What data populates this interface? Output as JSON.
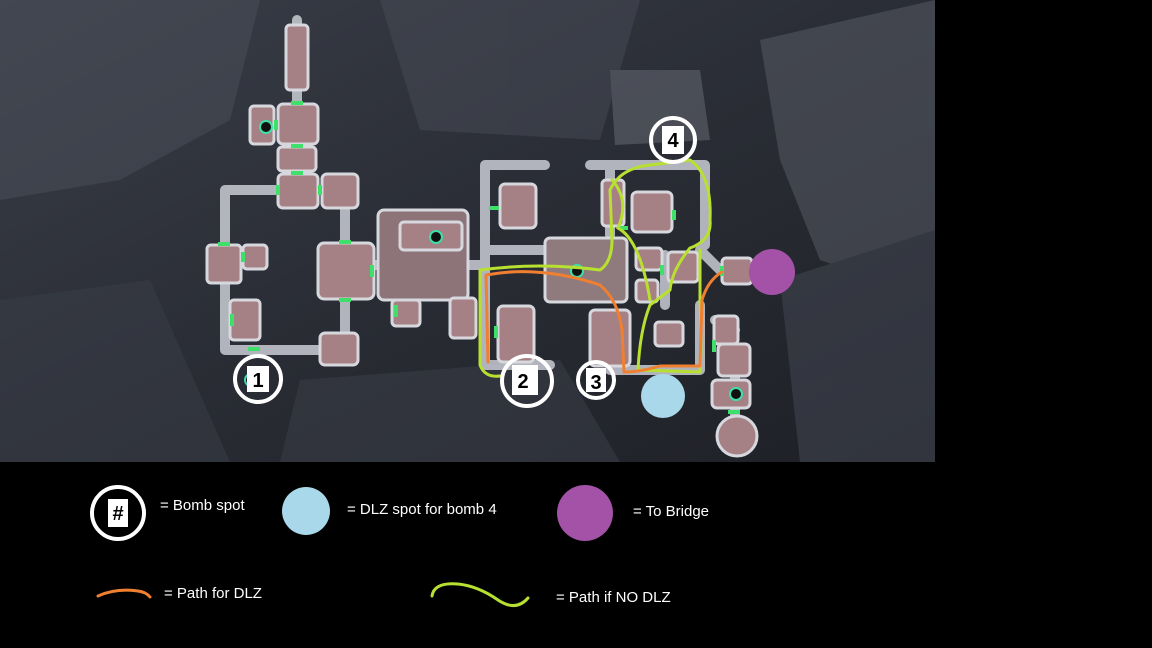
{
  "map": {
    "bomb_spots": [
      "1",
      "2",
      "3",
      "4"
    ],
    "colors": {
      "room_fill": "#b88a8c",
      "corridor": "#c9ccd4",
      "door": "#3ee06a",
      "path_dlz": "#f08030",
      "path_no_dlz": "#b8e030",
      "dlz_spot": "#a8d8ea",
      "to_bridge": "#a352a8",
      "background": "#2b2e36"
    }
  },
  "legend": {
    "bomb_symbol": "#",
    "bomb_spot": "= Bomb spot",
    "dlz_spot": "= DLZ spot for bomb 4",
    "to_bridge": "= To Bridge",
    "path_dlz": "= Path for DLZ",
    "path_no_dlz": "= Path if NO DLZ"
  }
}
